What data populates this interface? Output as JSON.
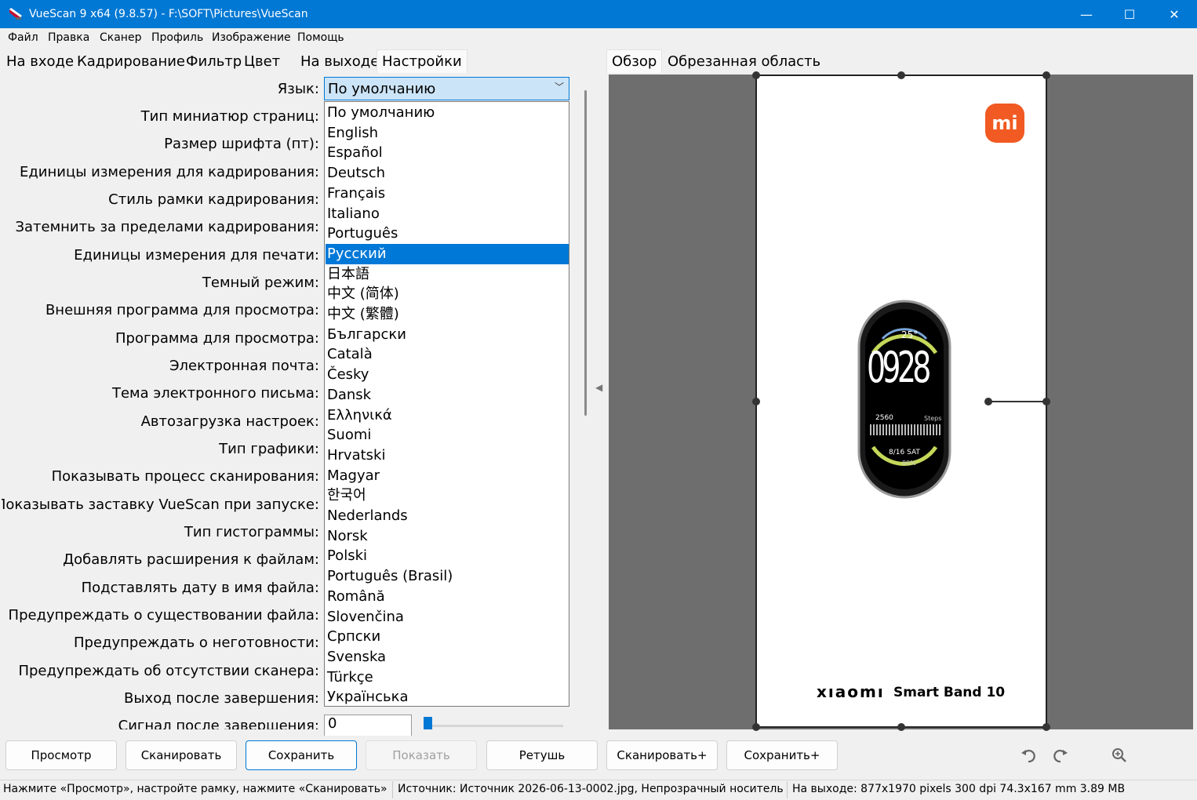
{
  "window": {
    "title": "VueScan 9 x64 (9.8.57) - F:\\SOFT\\Pictures\\VueScan",
    "minimize": "—",
    "maximize": "☐",
    "close": "✕"
  },
  "menu": [
    "Файл",
    "Правка",
    "Сканер",
    "Профиль",
    "Изображение",
    "Помощь"
  ],
  "left_tabs": [
    "На входе",
    "Кадрирование",
    "Фильтр",
    "Цвет",
    "На выходе",
    "Настройки"
  ],
  "active_left_tab": "Настройки",
  "right_tabs": [
    "Обзор",
    "Обрезанная область"
  ],
  "settings_labels": [
    "Язык:",
    "Тип миниатюр страниц:",
    "Размер шрифта (пт):",
    "Единицы измерения для кадрирования:",
    "Стиль рамки кадрирования:",
    "Затемнить за пределами кадрирования:",
    "Единицы измерения для печати:",
    "Темный режим:",
    "Внешняя программа для просмотра:",
    "Программа для просмотра:",
    "Электронная почта:",
    "Тема электронного письма:",
    "Автозагрузка настроек:",
    "Тип графики:",
    "Показывать процесс сканирования:",
    "Показывать заставку VueScan при запуске:",
    "Тип гистограммы:",
    "Добавлять расширения к файлам:",
    "Подставлять дату в имя файла:",
    "Предупреждать о существовании файла:",
    "Предупреждать о неготовности:",
    "Предупреждать об отсутствии сканера:",
    "Выход после завершения:",
    "Сигнал после завершения:"
  ],
  "language_select": {
    "value": "По умолчанию"
  },
  "language_options": [
    "По умолчанию",
    "English",
    "Español",
    "Deutsch",
    "Français",
    "Italiano",
    "Português",
    "Русский",
    "日本語",
    "中文 (简体)",
    "中文 (繁體)",
    "Български",
    "Català",
    "Česky",
    "Dansk",
    "Ελληνικά",
    "Suomi",
    "Hrvatski",
    "Magyar",
    "한국어",
    "Nederlands",
    "Norsk",
    "Polski",
    "Português (Brasil)",
    "Română",
    "Slovenčina",
    "Српски",
    "Svenska",
    "Türkçe",
    "Українська"
  ],
  "selected_language_index": 7,
  "signal_value": "0",
  "signal_slider_level": 0.0,
  "preview": {
    "logo_text": "mi",
    "band_time": "0928",
    "band_temp": "25°",
    "band_steps": "2560",
    "band_steps_label": "Steps",
    "band_date": "8/16 SAT",
    "band_battery": "80%",
    "brand": "xıaomı",
    "product": "Smart Band 10"
  },
  "buttons": [
    "Просмотр",
    "Сканировать",
    "Сохранить",
    "Показать",
    "Ретушь",
    "Сканировать+",
    "Сохранить+"
  ],
  "icons": {
    "rotate_left": "rotate-left-icon",
    "rotate_right": "rotate-right-icon",
    "zoom": "zoom-in-icon"
  },
  "colors": {
    "accent": "#0078d4",
    "selection": "#0078d7",
    "logo": "#f15a22"
  },
  "status": {
    "hint": "Нажмите «Просмотр», настройте рамку, нажмите «Сканировать»",
    "source": "Источник: Источник 2026-06-13-0002.jpg, Непрозрачный носитель",
    "output": "На выходе: 877x1970 pixels 300 dpi 74.3x167 mm 3.89 MB"
  }
}
